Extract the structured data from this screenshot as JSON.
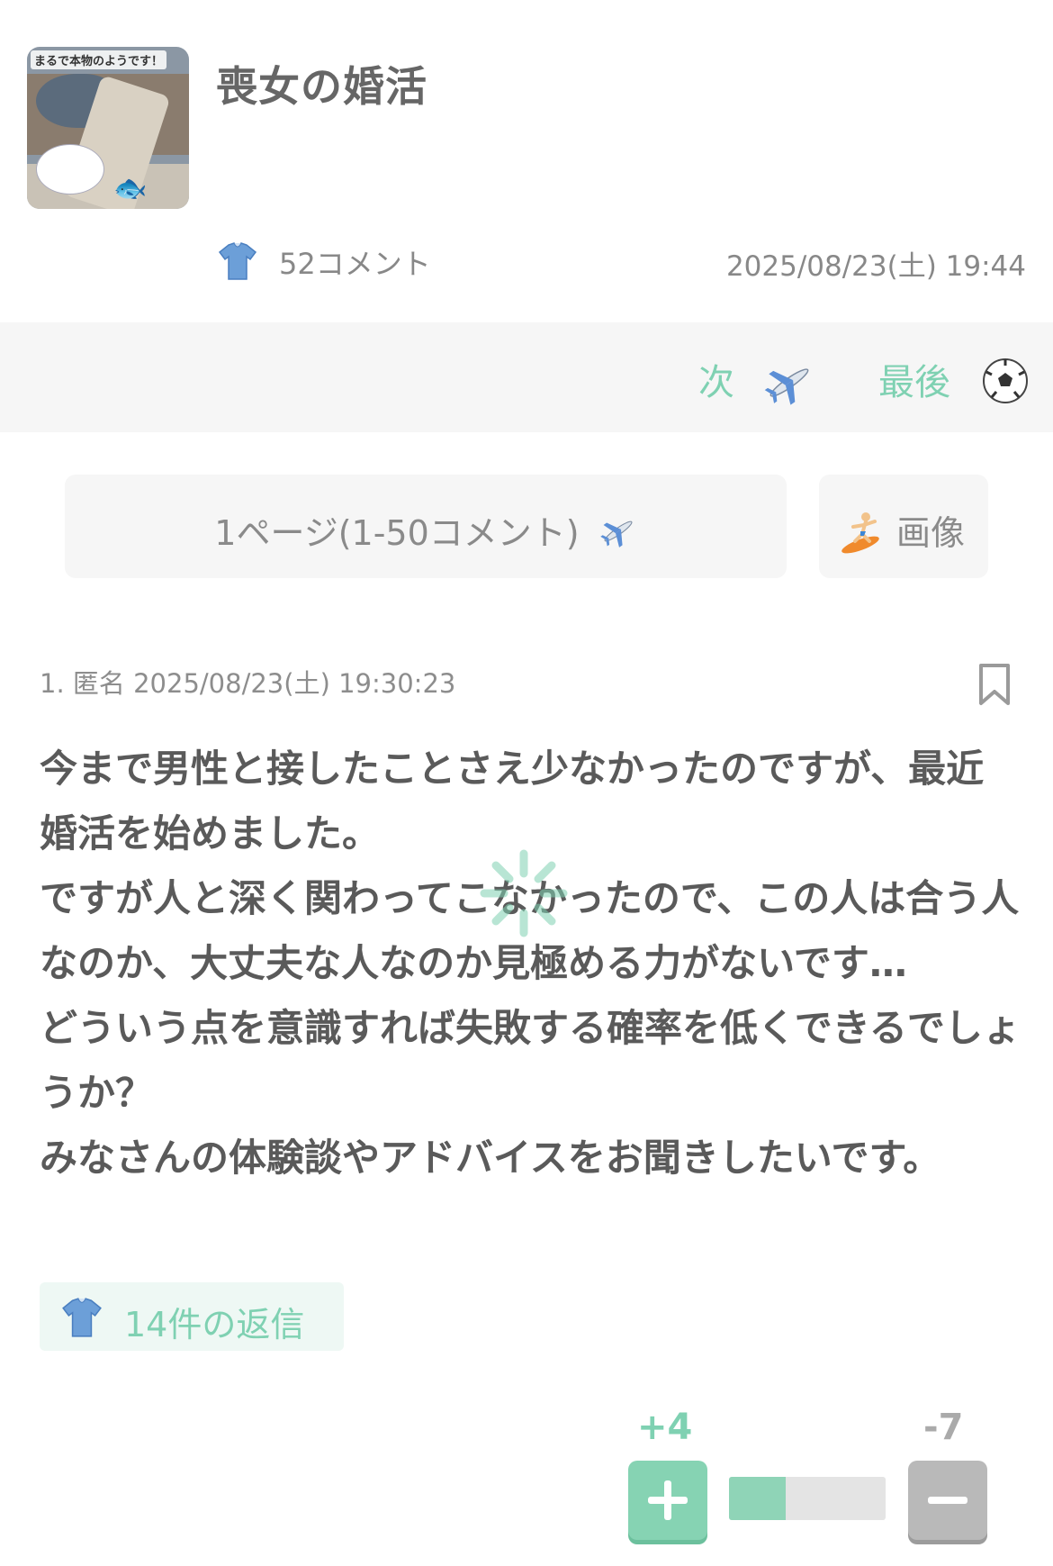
{
  "topic": {
    "thumbnail_caption": "まるで本物のようです！",
    "title": "喪女の婚活",
    "comment_count": "52コメント",
    "date": "2025/08/23(土) 19:44"
  },
  "nav": {
    "next_label": "次",
    "last_label": "最後"
  },
  "page_selector": {
    "label": "1ページ(1-50コメント)",
    "images_label": "画像"
  },
  "comment": {
    "meta": "1. 匿名 2025/08/23(土) 19:30:23",
    "lines": [
      "今まで男性と接したことさえ少なかったのですが、最近婚活を始めました。",
      "ですが人と深く関わってこなかったので、この人は合う人なのか、大丈夫な人なのか見極める力がないです…",
      "どういう点を意識すれば失敗する確率を低くできるでしょうか？",
      "みなさんの体験談やアドバイスをお聞きしたいです。"
    ],
    "replies_label": "14件の返信",
    "plus_votes": "+4",
    "minus_votes": "-7",
    "plus_ratio": 0.36
  },
  "colors": {
    "accent": "#7fd1b2",
    "plus_button": "#86d3b3",
    "minus_button": "#b9b9b9"
  },
  "icons": [
    "shirt-icon",
    "plane-icon",
    "soccer-ball-icon",
    "surfer-icon",
    "bookmark-icon",
    "plus-icon",
    "minus-icon",
    "loading-spinner-icon"
  ]
}
